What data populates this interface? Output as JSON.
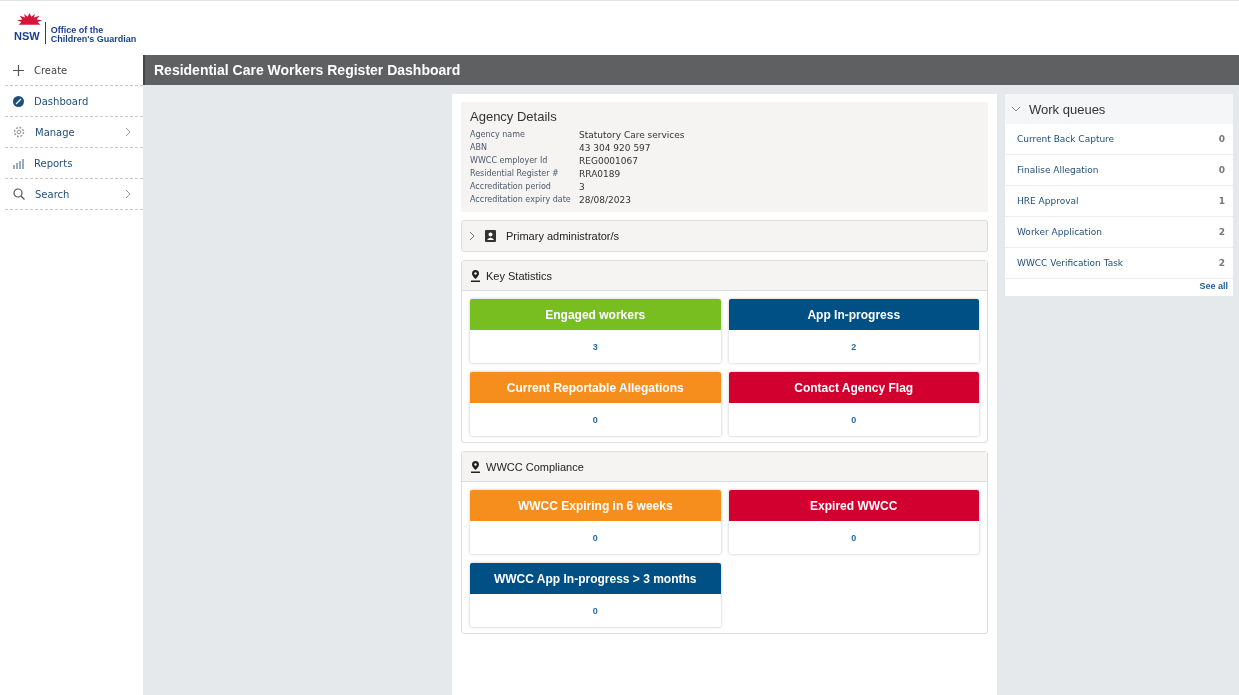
{
  "logo": {
    "short": "NSW",
    "name_line1": "Office of the",
    "name_line2": "Children's Guardian"
  },
  "nav": [
    {
      "label": "Create",
      "kind": "create",
      "submenu": false
    },
    {
      "label": "Dashboard",
      "kind": "dashboard",
      "submenu": false
    },
    {
      "label": "Manage",
      "kind": "manage",
      "submenu": true
    },
    {
      "label": "Reports",
      "kind": "reports",
      "submenu": false
    },
    {
      "label": "Search",
      "kind": "search",
      "submenu": true
    }
  ],
  "page_title": "Residential Care Workers Register Dashboard",
  "agency": {
    "title": "Agency Details",
    "fields": [
      {
        "label": "Agency name",
        "value": "Statutory Care services"
      },
      {
        "label": "ABN",
        "value": "43 304 920 597"
      },
      {
        "label": "WWCC employer Id",
        "value": "REG0001067"
      },
      {
        "label": "Residential Register #",
        "value": "RRA0189"
      },
      {
        "label": "Accreditation period",
        "value": "3"
      },
      {
        "label": "Accreditation expiry date",
        "value": "28/08/2023"
      }
    ]
  },
  "primary_admin": {
    "title": "Primary administrator/s",
    "expanded": false
  },
  "sections": [
    {
      "title": "Key Statistics",
      "tiles": [
        {
          "label": "Engaged workers",
          "value": "3",
          "color": "#78be20"
        },
        {
          "label": "App In-progress",
          "value": "2",
          "color": "#005085"
        },
        {
          "label": "Current Reportable Allegations",
          "value": "0",
          "color": "#f68e1e"
        },
        {
          "label": "Contact Agency Flag",
          "value": "0",
          "color": "#d1002f"
        }
      ]
    },
    {
      "title": "WWCC Compliance",
      "tiles": [
        {
          "label": "WWCC Expiring in 6 weeks",
          "value": "0",
          "color": "#f68e1e"
        },
        {
          "label": "Expired WWCC",
          "value": "0",
          "color": "#d1002f"
        },
        {
          "label": "WWCC App In-progress > 3 months",
          "value": "0",
          "color": "#005085"
        }
      ]
    }
  ],
  "work_queues": {
    "title": "Work queues",
    "expanded": true,
    "items": [
      {
        "label": "Current Back Capture",
        "count": "0"
      },
      {
        "label": "Finalise Allegation",
        "count": "0"
      },
      {
        "label": "HRE Approval",
        "count": "1"
      },
      {
        "label": "Worker Application",
        "count": "2"
      },
      {
        "label": "WWCC Verification Task",
        "count": "2"
      }
    ],
    "see_all": "See all"
  }
}
